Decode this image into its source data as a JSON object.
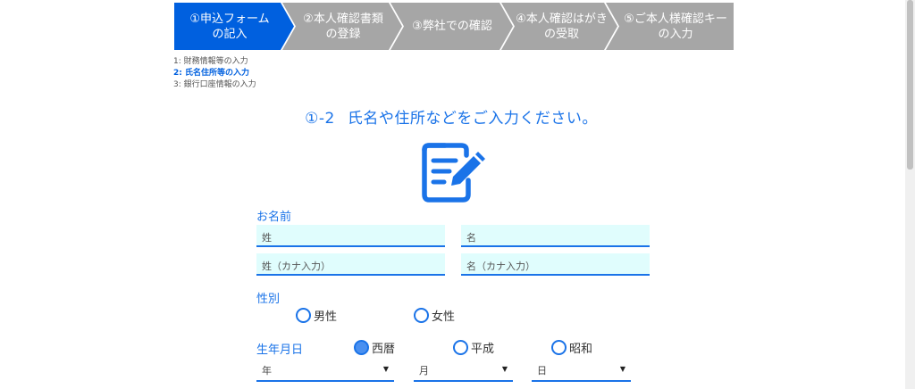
{
  "steps": [
    {
      "label": "①申込フォーム\nの記入",
      "active": true
    },
    {
      "label": "②本人確認書類\nの登録",
      "active": false
    },
    {
      "label": "③弊社での確認",
      "active": false
    },
    {
      "label": "④本人確認はがき\nの受取",
      "active": false
    },
    {
      "label": "⑤ご本人様確認キー\nの入力",
      "active": false
    }
  ],
  "substeps": [
    "1: 財務情報等の入力",
    "2: 氏名住所等の入力",
    "3: 銀行口座情報の入力"
  ],
  "heading": {
    "num": "①-2",
    "text": "氏名や住所などをご入力ください。"
  },
  "form_icon": "edit-document-icon",
  "name_section": {
    "label": "お名前",
    "last_name_placeholder": "姓",
    "first_name_placeholder": "名",
    "last_name_kana_placeholder": "姓（カナ入力）",
    "first_name_kana_placeholder": "名（カナ入力）"
  },
  "gender_section": {
    "label": "性別",
    "options": [
      "男性",
      "女性"
    ]
  },
  "birth_section": {
    "label": "生年月日",
    "era_options": [
      "西暦",
      "平成",
      "昭和"
    ],
    "selected_era": "西暦",
    "year_placeholder": "年",
    "month_placeholder": "月",
    "day_placeholder": "日"
  },
  "colors": {
    "active_step": "#0060df",
    "inactive_step": "#a6a6a6",
    "accent": "#1a73e8",
    "field_bg": "#e0fdfd"
  }
}
